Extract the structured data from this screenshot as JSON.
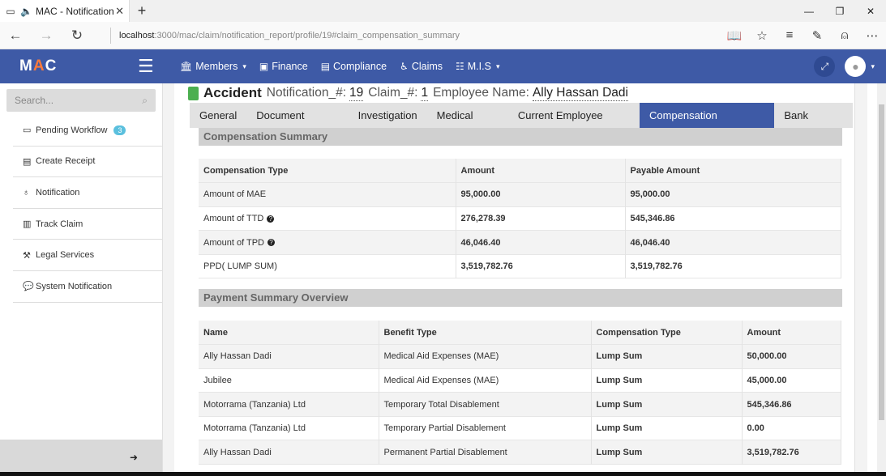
{
  "browser": {
    "tab_title": "MAC - Notification",
    "url_host": "localhost",
    "url_path": ":3000/mac/claim/notification_report/profile/19#claim_compensation_summary",
    "new_tab": "+",
    "win_min": "—",
    "win_max": "❐",
    "win_close": "✕"
  },
  "header": {
    "logo_m": "M",
    "logo_a": "A",
    "logo_c": "C",
    "menu": [
      {
        "label": "Members",
        "icon": "bank-icon",
        "caret": true
      },
      {
        "label": "Finance",
        "icon": "money-icon",
        "caret": false
      },
      {
        "label": "Compliance",
        "icon": "book-icon",
        "caret": false
      },
      {
        "label": "Claims",
        "icon": "wheelchair-icon",
        "caret": false
      },
      {
        "label": "M.I.S",
        "icon": "list-icon",
        "caret": true
      }
    ]
  },
  "sidebar": {
    "search_placeholder": "Search...",
    "items": [
      {
        "label": "Pending Workflow",
        "badge": "3",
        "icon": "inbox-icon"
      },
      {
        "label": "Create Receipt",
        "icon": "receipt-icon"
      },
      {
        "label": "Notification",
        "icon": "stethoscope-icon"
      },
      {
        "label": "Track Claim",
        "icon": "chart-icon"
      },
      {
        "label": "Legal Services",
        "icon": "gavel-icon"
      },
      {
        "label": "System Notification",
        "icon": "comments-icon"
      }
    ]
  },
  "page": {
    "accident": "Accident",
    "notification_label": "Notification_#:",
    "notification_value": "19",
    "claim_label": "Claim_#:",
    "claim_value": "1",
    "employee_label": "Employee Name:",
    "employee_value": "Ally Hassan Dadi"
  },
  "tabs": [
    {
      "label": "General",
      "active": false
    },
    {
      "label": "Document Centre",
      "active": false
    },
    {
      "label": "Investigation",
      "active": false
    },
    {
      "label": "Medical Care",
      "active": false
    },
    {
      "label": "Current Employee State",
      "active": false
    },
    {
      "label": "Compensation Summary",
      "active": true
    },
    {
      "label": "Bank Details",
      "active": false
    }
  ],
  "compensation": {
    "title": "Compensation Summary",
    "headers": [
      "Compensation Type",
      "Amount",
      "Payable Amount"
    ],
    "rows": [
      {
        "type": "Amount of MAE",
        "amount": "95,000.00",
        "payable": "95,000.00",
        "help": false
      },
      {
        "type": "Amount of TTD",
        "amount": "276,278.39",
        "payable": "545,346.86",
        "help": true
      },
      {
        "type": "Amount of TPD",
        "amount": "46,046.40",
        "payable": "46,046.40",
        "help": true
      },
      {
        "type": "PPD( LUMP SUM)",
        "amount": "3,519,782.76",
        "payable": "3,519,782.76",
        "help": false
      }
    ]
  },
  "payments": {
    "title": "Payment Summary Overview",
    "headers": [
      "Name",
      "Benefit Type",
      "Compensation Type",
      "Amount"
    ],
    "rows": [
      {
        "name": "Ally Hassan Dadi",
        "benefit": "Medical Aid Expenses (MAE)",
        "comp": "Lump Sum",
        "amount": "50,000.00"
      },
      {
        "name": "Jubilee",
        "benefit": "Medical Aid Expenses (MAE)",
        "comp": "Lump Sum",
        "amount": "45,000.00"
      },
      {
        "name": "Motorrama (Tanzania) Ltd",
        "benefit": "Temporary Total Disablement",
        "comp": "Lump Sum",
        "amount": "545,346.86"
      },
      {
        "name": "Motorrama (Tanzania) Ltd",
        "benefit": "Temporary Partial Disablement",
        "comp": "Lump Sum",
        "amount": "0.00"
      },
      {
        "name": "Ally Hassan Dadi",
        "benefit": "Permanent Partial Disablement",
        "comp": "Lump Sum",
        "amount": "3,519,782.76"
      }
    ]
  }
}
